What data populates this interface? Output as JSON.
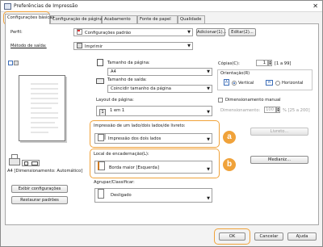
{
  "window": {
    "title": "Preferências de Impressão",
    "close_glyph": "✕"
  },
  "tabs": [
    {
      "label": "Configurações básicas",
      "active": true
    },
    {
      "label": "Configuração de página"
    },
    {
      "label": "Acabamento"
    },
    {
      "label": "Fonte de papel"
    },
    {
      "label": "Qualidade"
    }
  ],
  "profile": {
    "label": "Perfil:",
    "value": "Configurações padrão",
    "add_label": "Adicionar(1)...",
    "edit_label": "Editar(2)..."
  },
  "output_method": {
    "label": "Método de saída:",
    "value": "Imprimir"
  },
  "preview": {
    "caption": "A4 [Dimensionamento: Automático]",
    "view_settings_label": "Exibir configurações",
    "restore_defaults_label": "Restaurar padrões"
  },
  "page_size": {
    "label": "Tamanho da página:",
    "value": "A4"
  },
  "output_size": {
    "label": "Tamanho de saída:",
    "value": "Coincidir tamanho da página"
  },
  "copies": {
    "label": "Cópias(C):",
    "value": "1",
    "range": "[1 a 99]"
  },
  "orientation": {
    "label": "Orientação(R)",
    "vertical_label": "Vertical",
    "horizontal_label": "Horizontal",
    "selected": "Vertical"
  },
  "page_layout": {
    "label": "Layout de página:",
    "value": "1 em 1",
    "icon_text": "1"
  },
  "manual_scaling": {
    "label": "Dimensionamento manual",
    "field_label": "Dimensionamento:",
    "value": "100",
    "range": "% [25 a 200]"
  },
  "duplex": {
    "label": "Impressão de um lado/dois lados/de livreto:",
    "value": "Impressão dos dois lados",
    "booklet_label": "Livreto..."
  },
  "binding": {
    "label": "Local de encadernação(L):",
    "value": "Borda maior [Esquerda]",
    "margin_label": "Medianiz..."
  },
  "collate": {
    "label": "Agrupar/Classificar:",
    "value": "Desligado"
  },
  "footer": {
    "ok_label": "OK",
    "cancel_label": "Cancelar",
    "help_label": "Ajuda"
  },
  "callouts": {
    "a": "a",
    "b": "b",
    "color": "#f0a23a"
  }
}
